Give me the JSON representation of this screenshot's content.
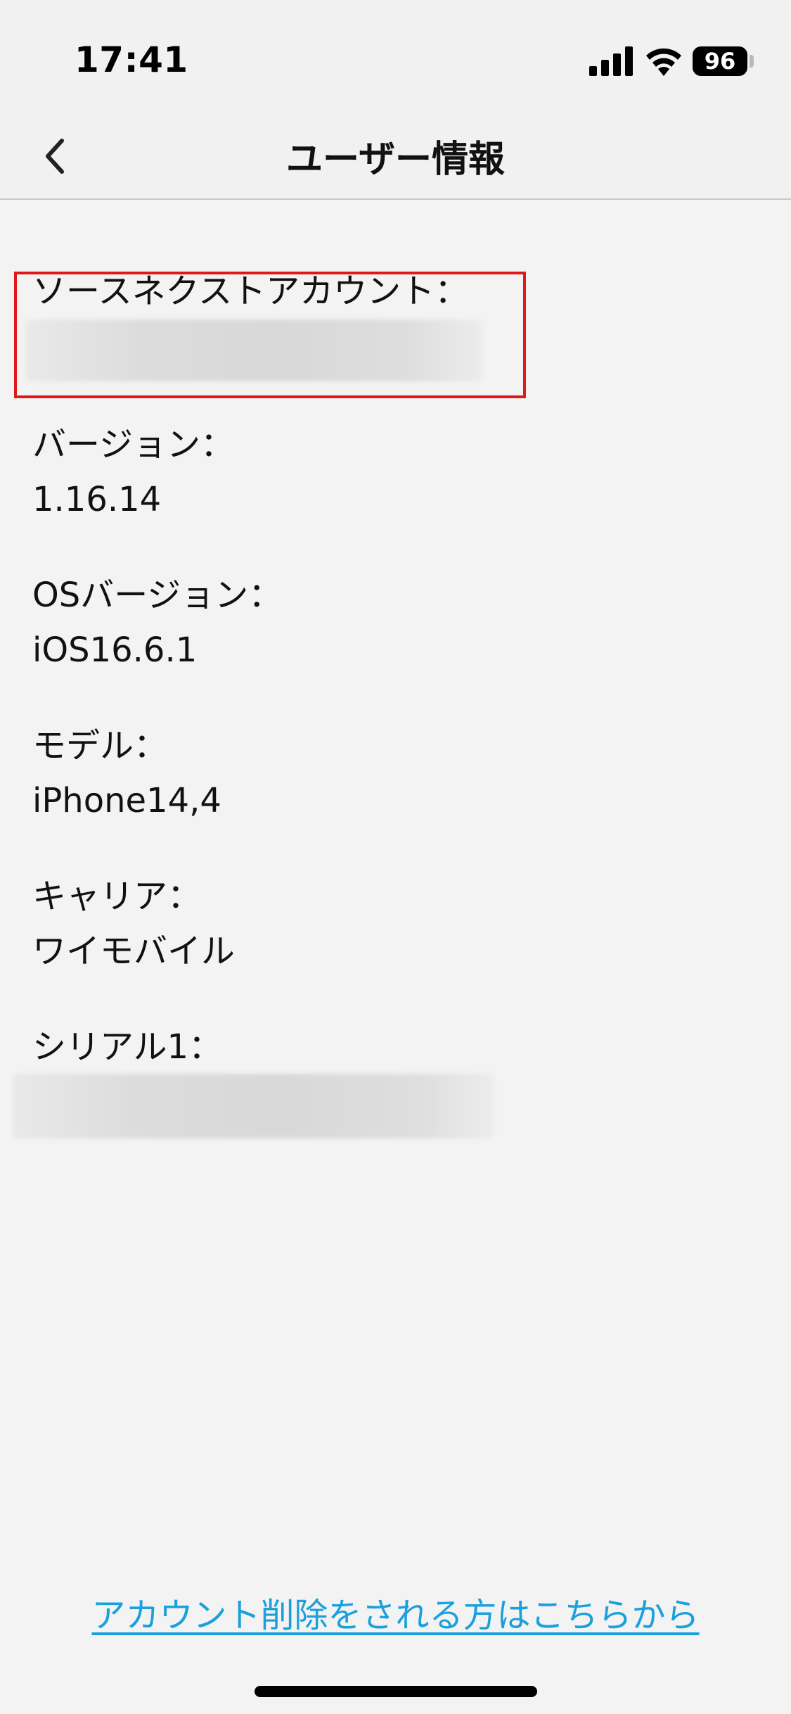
{
  "status_bar": {
    "time": "17:41",
    "battery": "96",
    "icons": [
      "cellular-signal-icon",
      "wifi-icon",
      "battery-icon"
    ]
  },
  "nav": {
    "title": "ユーザー情報",
    "back_icon": "chevron-left-icon"
  },
  "info": {
    "account_label": "ソースネクストアカウント：",
    "version_label": "バージョン：",
    "version_value": "1.16.14",
    "os_version_label": "OSバージョン：",
    "os_version_value": "iOS16.6.1",
    "model_label": "モデル：",
    "model_value": "iPhone14,4",
    "carrier_label": "キャリア：",
    "carrier_value": "ワイモバイル",
    "serial_label": "シリアル1："
  },
  "footer": {
    "delete_account_link": "アカウント削除をされる方はこちらから"
  },
  "colors": {
    "background": "#f3f3f3",
    "link": "#1aa0dc",
    "highlight": "#e01818"
  }
}
